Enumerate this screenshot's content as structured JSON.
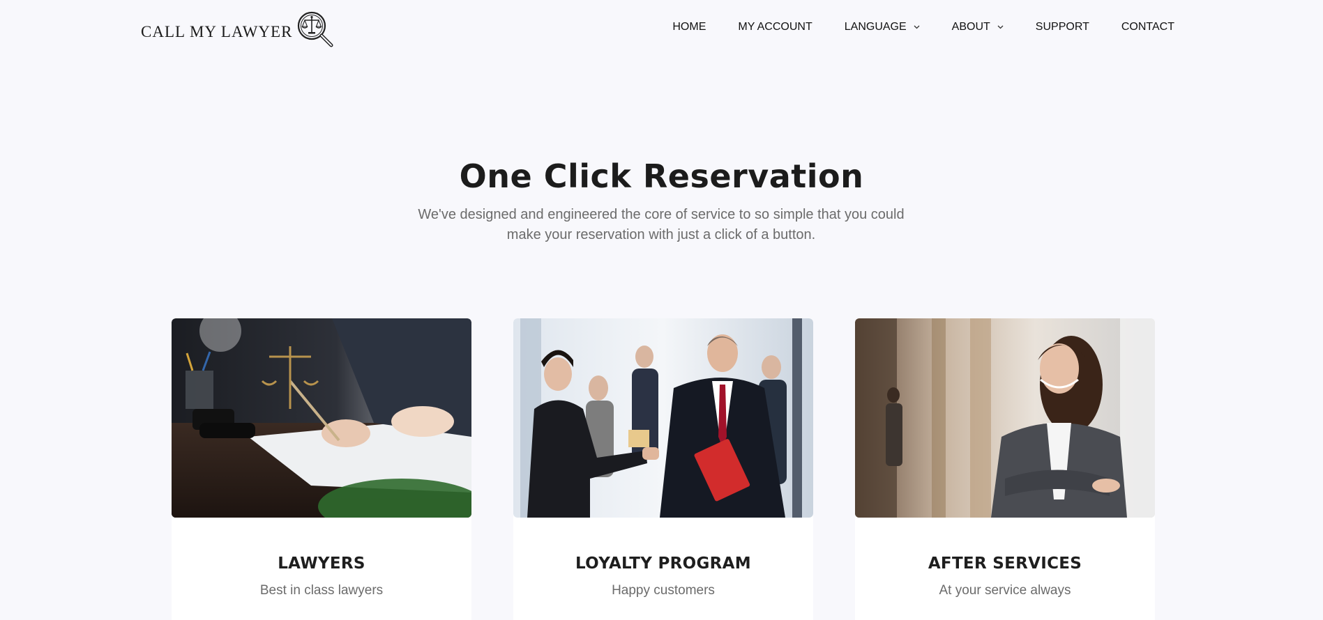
{
  "header": {
    "logo_text": "CALL MY LAWYER",
    "nav": [
      {
        "label": "HOME",
        "has_dropdown": false
      },
      {
        "label": "MY ACCOUNT",
        "has_dropdown": false
      },
      {
        "label": "LANGUAGE",
        "has_dropdown": true
      },
      {
        "label": "ABOUT",
        "has_dropdown": true
      },
      {
        "label": "SUPPORT",
        "has_dropdown": false
      },
      {
        "label": "CONTACT",
        "has_dropdown": false
      }
    ]
  },
  "hero": {
    "title": "One Click Reservation",
    "subtitle": "We've designed and engineered the core of service to so simple that you could make your reservation with just a click of a button."
  },
  "cards": [
    {
      "title": "LAWYERS",
      "subtitle": "Best in class lawyers",
      "image": "lawyer-signing-document-with-gavel-and-scales-photo"
    },
    {
      "title": "LOYALTY PROGRAM",
      "subtitle": "Happy customers",
      "image": "lawyer-shaking-hands-with-client-photo"
    },
    {
      "title": "AFTER SERVICES",
      "subtitle": "At your service always",
      "image": "smiling-businesswoman-arms-crossed-photo"
    }
  ],
  "colors": {
    "page_background": "#f8f8fc",
    "heading": "#1c1c1c",
    "muted_text": "#6b6b6b",
    "card_background": "#ffffff"
  }
}
